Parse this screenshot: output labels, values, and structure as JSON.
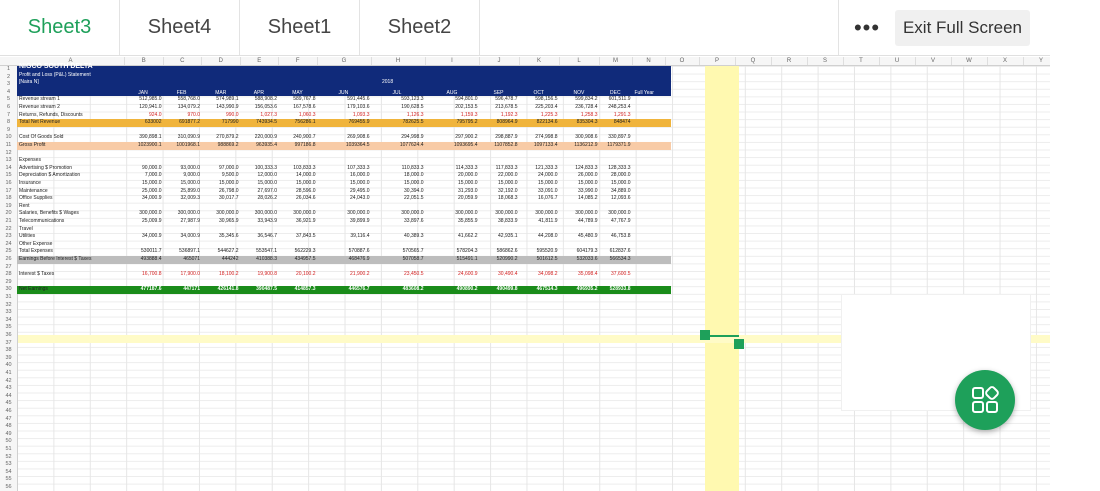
{
  "tabs": [
    {
      "label": "Sheet3",
      "active": true
    },
    {
      "label": "Sheet4",
      "active": false
    },
    {
      "label": "Sheet1",
      "active": false
    },
    {
      "label": "Sheet2",
      "active": false
    }
  ],
  "toolbar": {
    "more_label": "•••",
    "exit_label": "Exit Full Screen"
  },
  "columns": [
    "A",
    "B",
    "C",
    "D",
    "E",
    "F",
    "G",
    "H",
    "I",
    "J",
    "K",
    "L",
    "M",
    "N",
    "O",
    "P",
    "Q",
    "R",
    "S",
    "T",
    "U",
    "V",
    "W",
    "X",
    "Y"
  ],
  "statement": {
    "company": "NIGCO SOUTH DELTA",
    "title": "Profit and Loss (P&L) Statement",
    "currency": "[Naira N]",
    "year": "2018",
    "months": [
      "JAN",
      "FEB",
      "MAR",
      "APR",
      "MAY",
      "JUN",
      "JUL",
      "AUG",
      "SEP",
      "OCT",
      "NOV",
      "DEC"
    ],
    "full_year": "Full Year"
  },
  "rows": [
    {
      "r": 5,
      "label": "Revenue stream 1",
      "v": [
        "512,985.0",
        "558,768.0",
        "574,989.1",
        "588,908.2",
        "589,767.8",
        "591,445.6",
        "593,123.3",
        "594,801.0",
        "596,478.7",
        "598,156.5",
        "599,834.2",
        "601,511.9"
      ]
    },
    {
      "r": 6,
      "label": "Revenue stream 2",
      "v": [
        "120,941.0",
        "134,079.2",
        "143,990.9",
        "156,053.6",
        "167,578.6",
        "179,103.6",
        "190,628.5",
        "202,153.5",
        "213,678.5",
        "225,203.4",
        "236,728.4",
        "248,253.4"
      ]
    },
    {
      "r": 7,
      "label": "Returns, Refunds, Discounts",
      "v": [
        "924.0",
        "970.0",
        "990.0",
        "1,027.3",
        "1,060.3",
        "1,093.3",
        "1,126.3",
        "1,159.3",
        "1,192.3",
        "1,225.3",
        "1,258.3",
        "1,291.3"
      ],
      "red": true
    },
    {
      "r": 8,
      "label": "Total Net Revenue",
      "v": [
        "633002",
        "691877.2",
        "717990",
        "743934.5",
        "756286.1",
        "769455.9",
        "782625.5",
        "795795.2",
        "808964.9",
        "822134.6",
        "835304.3",
        "848474"
      ],
      "band": "orange"
    },
    {
      "r": 10,
      "label": "Cost Of Goods Sold",
      "v": [
        "390,898.1",
        "310,090.9",
        "270,879.2",
        "220,000.9",
        "240,900.7",
        "269,908.6",
        "294,998.9",
        "297,900.2",
        "298,887.9",
        "274,998.8",
        "300,908.6",
        "330,897.9"
      ]
    },
    {
      "r": 11,
      "label": "Gross Profit",
      "v": [
        "1023900.1",
        "1001968.1",
        "988869.2",
        "963935.4",
        "997186.8",
        "1039364.5",
        "1077624.4",
        "1093695.4",
        "1107852.8",
        "1097133.4",
        "1136212.9",
        "1179371.9"
      ],
      "band": "peach"
    },
    {
      "r": 13,
      "label": "Expenses",
      "v": []
    },
    {
      "r": 14,
      "label": "Advertising $ Promotion",
      "v": [
        "90,000.0",
        "93,000.0",
        "97,000.0",
        "100,333.3",
        "103,833.3",
        "107,333.3",
        "110,833.3",
        "114,333.3",
        "117,833.3",
        "121,333.3",
        "124,833.3",
        "128,333.3"
      ]
    },
    {
      "r": 15,
      "label": "Depreciation $ Amortization",
      "v": [
        "7,000.0",
        "9,000.0",
        "9,500.0",
        "12,000.0",
        "14,000.0",
        "16,000.0",
        "18,000.0",
        "20,000.0",
        "22,000.0",
        "24,000.0",
        "26,000.0",
        "28,000.0"
      ]
    },
    {
      "r": 16,
      "label": "Insurance",
      "v": [
        "15,000.0",
        "15,000.0",
        "15,000.0",
        "15,000.0",
        "15,000.0",
        "15,000.0",
        "15,000.0",
        "15,000.0",
        "15,000.0",
        "15,000.0",
        "15,000.0",
        "15,000.0"
      ]
    },
    {
      "r": 17,
      "label": "Maintenance",
      "v": [
        "25,000.0",
        "25,899.0",
        "26,798.0",
        "27,697.0",
        "28,596.0",
        "29,495.0",
        "30,394.0",
        "31,293.0",
        "32,192.0",
        "33,091.0",
        "33,990.0",
        "34,889.0"
      ]
    },
    {
      "r": 18,
      "label": "Office Supplies",
      "v": [
        "34,000.9",
        "32,009.3",
        "30,017.7",
        "28,026.2",
        "26,034.6",
        "24,043.0",
        "22,051.5",
        "20,059.9",
        "18,068.3",
        "16,076.7",
        "14,085.2",
        "12,093.6"
      ]
    },
    {
      "r": 19,
      "label": "Rent",
      "v": []
    },
    {
      "r": 20,
      "label": "Salaries, Benefits $ Wages",
      "v": [
        "300,000.0",
        "300,000.0",
        "300,000.0",
        "300,000.0",
        "300,000.0",
        "300,000.0",
        "300,000.0",
        "300,000.0",
        "300,000.0",
        "300,000.0",
        "300,000.0",
        "300,000.0"
      ]
    },
    {
      "r": 21,
      "label": "Telecommunications",
      "v": [
        "25,009.9",
        "27,987.9",
        "30,965.9",
        "33,943.9",
        "36,921.9",
        "39,899.9",
        "33,897.6",
        "35,855.9",
        "38,833.9",
        "41,811.9",
        "44,789.9",
        "47,767.9"
      ]
    },
    {
      "r": 22,
      "label": "Travel",
      "v": []
    },
    {
      "r": 23,
      "label": "Utilities",
      "v": [
        "34,000.9",
        "34,000.9",
        "35,345.6",
        "36,546.7",
        "37,843.5",
        "39,116.4",
        "40,389.3",
        "41,662.2",
        "42,935.1",
        "44,208.0",
        "45,480.9",
        "46,753.8"
      ]
    },
    {
      "r": 24,
      "label": "Other Expense",
      "v": []
    },
    {
      "r": 25,
      "label": "Total Expenses",
      "v": [
        "530011.7",
        "536897.1",
        "544627.2",
        "553547.1",
        "562229.3",
        "570887.6",
        "570565.7",
        "578204.3",
        "586862.6",
        "595520.9",
        "604179.3",
        "612837.6"
      ]
    },
    {
      "r": 26,
      "label": "Earnings Before Interest $ Taxes",
      "v": [
        "493888.4",
        "465071",
        "444242",
        "410388.3",
        "434957.5",
        "468476.9",
        "507058.7",
        "515491.1",
        "520990.2",
        "501612.5",
        "532033.6",
        "566534.3"
      ],
      "band": "gray"
    },
    {
      "r": 28,
      "label": "Interest $ Taxes",
      "v": [
        "16,700.8",
        "17,900.0",
        "18,100.2",
        "19,900.8",
        "20,100.2",
        "21,900.2",
        "23,450.5",
        "24,600.9",
        "30,490.4",
        "34,098.2",
        "35,098.4",
        "37,600.5"
      ],
      "red": true
    },
    {
      "r": 30,
      "label": "Net Earnings",
      "v": [
        "477187.6",
        "447171",
        "426141.8",
        "390487.5",
        "414857.3",
        "446576.7",
        "483608.2",
        "490890.2",
        "490499.8",
        "467514.3",
        "496935.2",
        "528933.8"
      ],
      "band": "green"
    }
  ],
  "colors": {
    "accent": "#1ea05a",
    "header_blue": "#102a7a",
    "orange": "#f0b43c",
    "peach": "#f8cba6",
    "gray": "#bdbdbd",
    "green": "#1a8c1a",
    "highlight": "#fff9b0"
  }
}
